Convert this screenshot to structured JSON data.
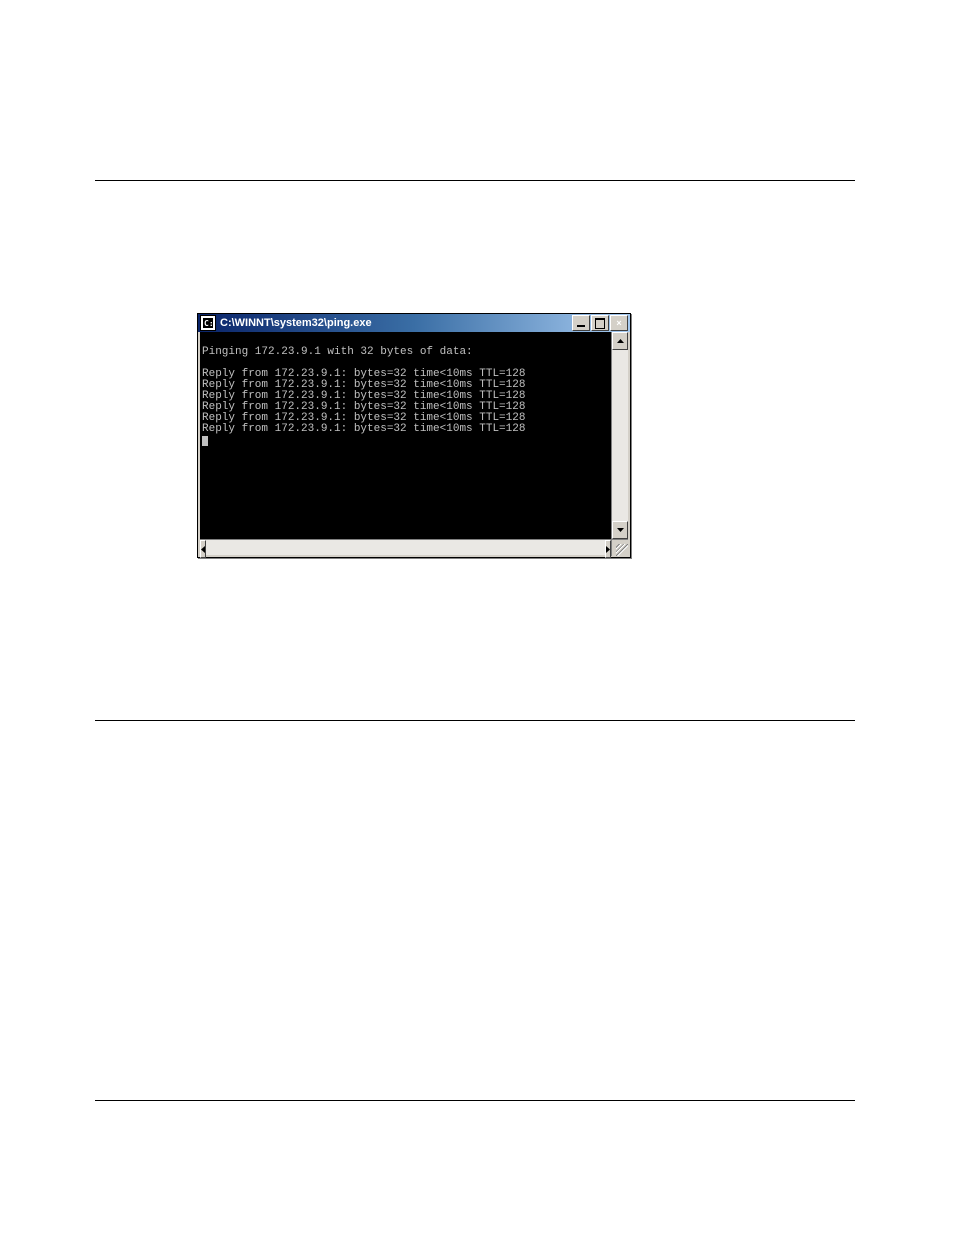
{
  "window": {
    "title": "C:\\WINNT\\system32\\ping.exe",
    "icon_label": "cmd"
  },
  "terminal": {
    "lines": [
      "",
      "Pinging 172.23.9.1 with 32 bytes of data:",
      "",
      "Reply from 172.23.9.1: bytes=32 time<10ms TTL=128",
      "Reply from 172.23.9.1: bytes=32 time<10ms TTL=128",
      "Reply from 172.23.9.1: bytes=32 time<10ms TTL=128",
      "Reply from 172.23.9.1: bytes=32 time<10ms TTL=128",
      "Reply from 172.23.9.1: bytes=32 time<10ms TTL=128",
      "Reply from 172.23.9.1: bytes=32 time<10ms TTL=128"
    ]
  },
  "buttons": {
    "close": "×"
  }
}
